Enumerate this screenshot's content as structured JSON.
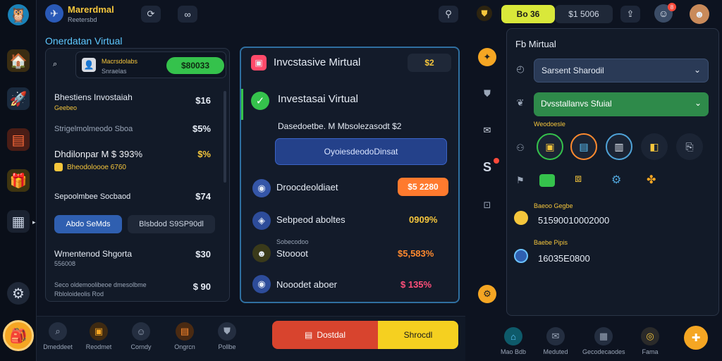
{
  "app": {
    "title": "Marerdmal",
    "subtitle": "Reetersbd"
  },
  "section_title": "Onerdatan Virtual",
  "account": {
    "name": "Macrsdolabs",
    "sub": "Snraelas",
    "balance": "$80033"
  },
  "left_rows": [
    {
      "label": "Bhestiens Invostaiah",
      "sub": "Geebeo",
      "value": "$16"
    },
    {
      "label": "Strigelmolmeodo Sboa",
      "sub": "",
      "value": "$5%"
    },
    {
      "label": "Dhdilonpar M $ 393%",
      "sub": "Bheodoloooe 6760",
      "value": "$%"
    },
    {
      "label": "Sepoolmbee Socbaod",
      "sub": "",
      "value": "$74"
    },
    {
      "label": "Wmentenod Shgorta",
      "sub": "556008",
      "value": "$30"
    },
    {
      "label": "Seco oldemoolibeoe dmesolbme",
      "sub": "Rbloloideolis Rod",
      "value": "$ 90"
    }
  ],
  "left_buttons": {
    "primary": "Abdo SeMds",
    "secondary": "Blsbdod S9SP90dl"
  },
  "center": {
    "header": "Invcstasive Mirtual",
    "header_badge": "$2",
    "title": "Investasai Virtual",
    "desc": "Dasedoetbe. M Mbsolezasodt $2",
    "cta": "OyoiesdeodoDinsat",
    "rows": [
      {
        "label": "Droocdeoldiaet",
        "value": "$5 2280",
        "style": "orange-pill"
      },
      {
        "label": "Sebpeod aboltes",
        "value": "0909%",
        "style": "yellow"
      },
      {
        "label": "Stoooot",
        "sub": "Sobecodoo",
        "value": "$5,583%",
        "style": "orange"
      },
      {
        "label": "Nooodet aboer",
        "value": "$ 135%",
        "style": "pink"
      }
    ]
  },
  "right": {
    "title": "Fb Mirtual",
    "select1": "Sarsent Sharodil",
    "select2": "Dvsstallanvs Sfuial",
    "sub_label": "Weodoesle",
    "stat1_label": "Baeoo Gegbe",
    "stat1_value": "51590010002000",
    "stat2_label": "Baebe Pipis",
    "stat2_value": "16035E0800"
  },
  "topbar": {
    "points": "Bo 36",
    "coins": "$1 5006",
    "notif_badge": "8"
  },
  "bottom_nav": [
    {
      "label": "Dmeddeet"
    },
    {
      "label": "Reodmet"
    },
    {
      "label": "Corndy"
    },
    {
      "label": "Ongrcn"
    },
    {
      "label": "Pollbe"
    }
  ],
  "bottom_buttons": {
    "left": "Dostdal",
    "right": "Shrocdl"
  },
  "right_nav": [
    {
      "label": "Mao Bdb"
    },
    {
      "label": "Meduted"
    },
    {
      "label": "Gecodecaodes"
    },
    {
      "label": "Fama"
    }
  ]
}
